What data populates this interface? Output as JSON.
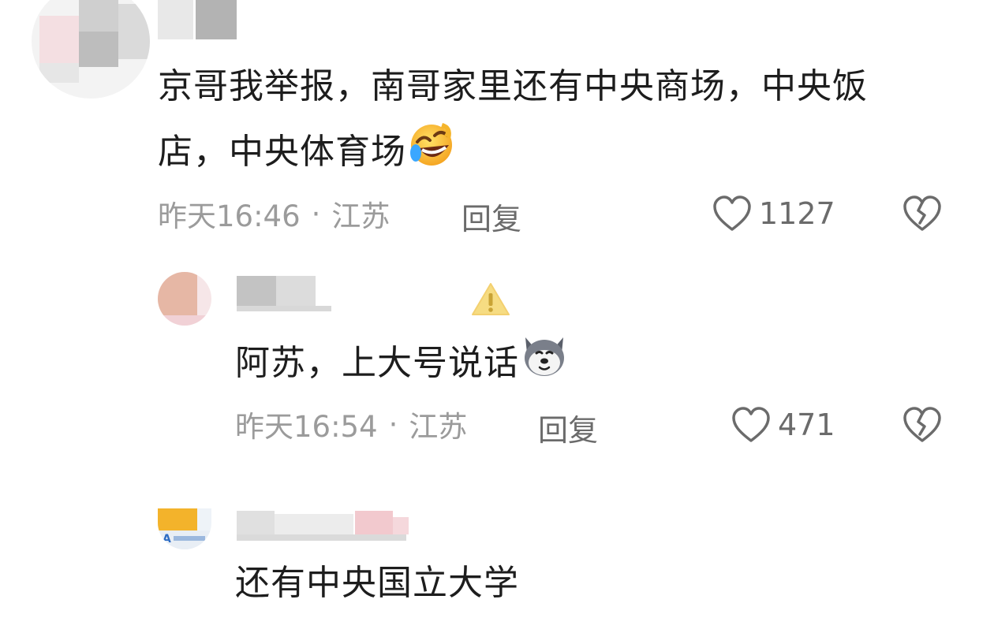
{
  "comments": [
    {
      "text_lines": [
        "京哥我举报，南哥家里还有中央商场，中央饭",
        "店，中央体育场"
      ],
      "emoji": "rolling-on-floor-laughing",
      "time": "昨天16:46",
      "separator": "·",
      "location": "江苏",
      "reply_label": "回复",
      "like_count": "1127"
    }
  ],
  "replies": [
    {
      "text": "阿苏，上大号说话",
      "emoji": "husky-dog-face",
      "time": "昨天16:54",
      "separator": "·",
      "location": "江苏",
      "reply_label": "回复",
      "like_count": "471"
    },
    {
      "text": "还有中央国立大学"
    }
  ],
  "icons": {
    "like": "heart-outline-icon",
    "dislike": "broken-heart-icon",
    "warning": "warning-triangle-icon"
  },
  "colors": {
    "text": "#1d1d1d",
    "meta": "#9b9b9b",
    "action": "#6b6b6b",
    "warning": "#f6d97a"
  }
}
